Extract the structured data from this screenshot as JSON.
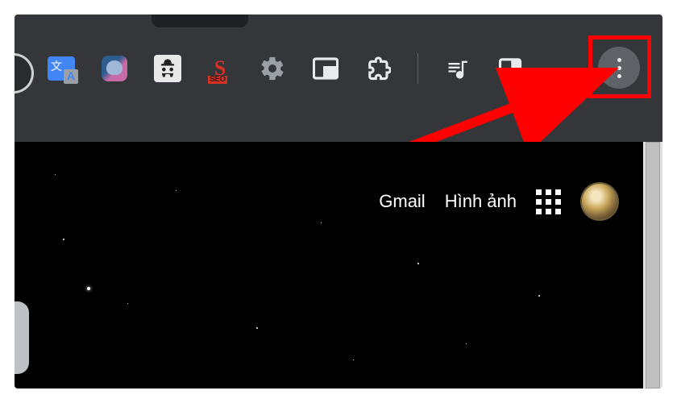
{
  "extensions": [
    {
      "id": "google-translate"
    },
    {
      "id": "evernote"
    },
    {
      "id": "anonymous-hacker"
    },
    {
      "id": "seoquake",
      "label_main": "S",
      "label_sub": "SEO"
    },
    {
      "id": "settings-gear"
    },
    {
      "id": "picture-in-picture"
    },
    {
      "id": "extensions-puzzle"
    }
  ],
  "toolbar": {
    "media_control": "media-control",
    "side_panel": "side-panel",
    "more": "more-menu"
  },
  "page": {
    "links": {
      "gmail": "Gmail",
      "images": "Hình ảnh"
    }
  },
  "annotation": {
    "highlight_target": "chrome-more-menu-button"
  }
}
